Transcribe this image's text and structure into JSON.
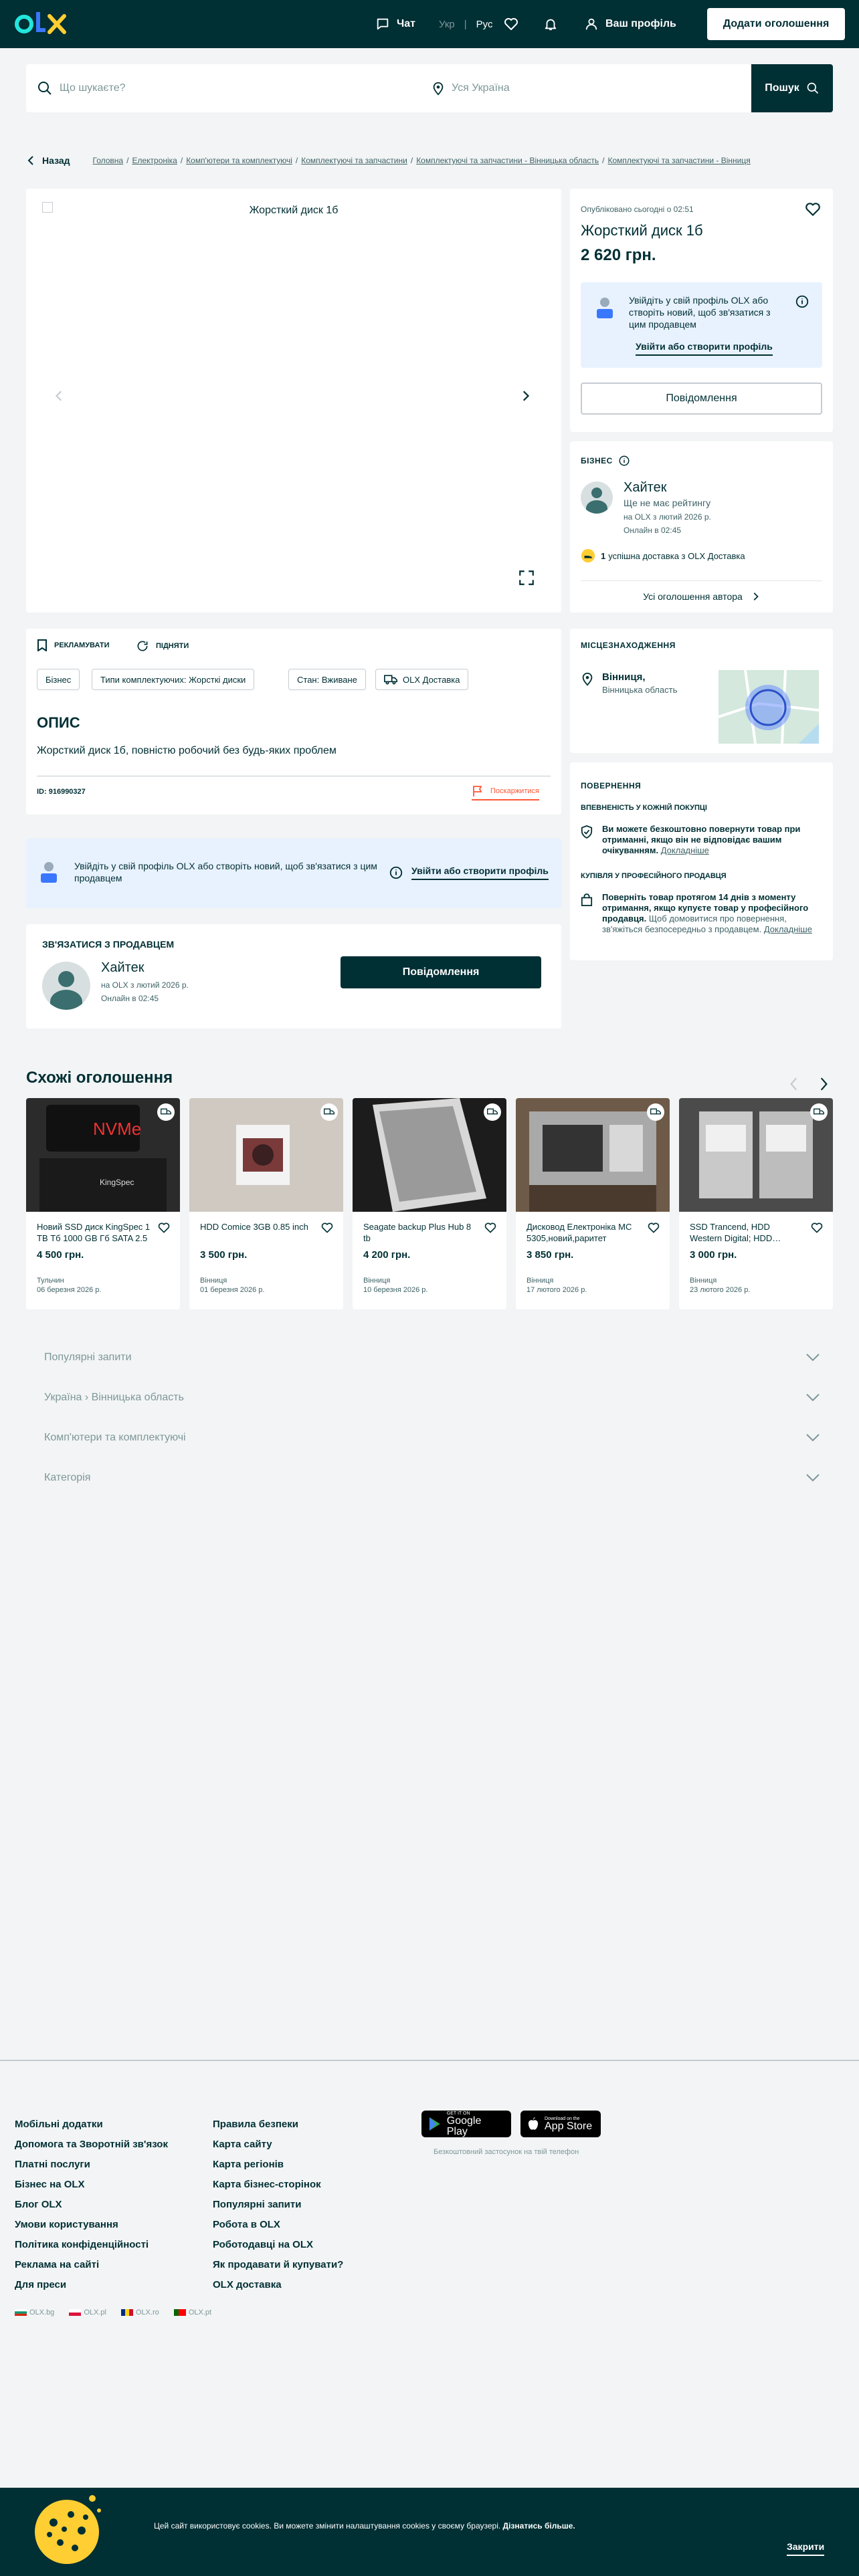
{
  "header": {
    "chat": "Чат",
    "lang_ukr": "Укр",
    "lang_rus": "Рус",
    "profile": "Ваш профіль",
    "add_listing": "Додати оголошення"
  },
  "search": {
    "placeholder": "Що шукаєте?",
    "location_placeholder": "Уся Україна",
    "button": "Пошук"
  },
  "breadcrumb": {
    "back": "Назад",
    "items": [
      "Головна",
      "Електроніка",
      "Комп'ютери та комплектуючі",
      "Комплектуючі та запчастини",
      "Комплектуючі та запчастини - Вінницька область",
      "Комплектуючі та запчастини - Вінниця"
    ]
  },
  "listing": {
    "image_alt": "Жорсткий диск 1б",
    "published": "Опубліковано сьогодні о 02:51",
    "title": "Жорсткий диск 1б",
    "price": "2 620 грн.",
    "login_prompt": "Увійдіть у свій профіль OLX або створіть новий, щоб зв'язатися з цим продавцем",
    "login_link": "Увійти або створити профіль",
    "message_button": "Повідомлення",
    "promote": "РЕКЛАМУВАТИ",
    "raise": "ПІДНЯТИ",
    "tags": [
      "Бізнес",
      "Типи комплектуючих: Жорсткі диски",
      "Стан: Вживане",
      "OLX Доставка"
    ],
    "description_heading": "ОПИС",
    "description": "Жорсткий диск 1б, повністю робочий без будь-яких проблем",
    "id_label": "ID: 916990327",
    "report": "Поскаржитися",
    "login_banner_text": "Увійдіть у свій профіль OLX або створіть новий, щоб зв'язатися з цим продавцем",
    "login_banner_link": "Увійти або створити профіль"
  },
  "seller": {
    "section": "БІЗНЕС",
    "name": "Хайтек",
    "rating": "Ще не має рейтингу",
    "since": "на OLX з лютий 2026 р.",
    "online": "Онлайн в 02:45",
    "delivery": "успішна доставка з OLX Доставка",
    "delivery_count": "1",
    "all_ads": "Усі оголошення автора"
  },
  "location": {
    "heading": "МІСЦЕЗНАХОДЖЕННЯ",
    "city": "Вінниця,",
    "region": "Вінницька область"
  },
  "returns": {
    "heading": "ПОВЕРНЕННЯ",
    "sub1": "ВПЕВНЕНІСТЬ У КОЖНІЙ ПОКУПЦІ",
    "text1": "Ви можете безкоштовно повернути товар при отриманні, якщо він не відповідає вашим очікуванням.",
    "link1": "Докладніше",
    "sub2": "КУПІВЛЯ У ПРОФЕСІЙНОГО ПРОДАВЦЯ",
    "text2_bold": "Поверніть товар протягом 14 днів з моменту отримання, якщо купуєте товар у професійного продавця.",
    "text2": "Щоб домовитися про повернення, зв'яжіться безпосередньо з продавцем.",
    "link2": "Докладніше"
  },
  "contact": {
    "heading": "ЗВ'ЯЗАТИСЯ З ПРОДАВЦЕМ",
    "name": "Хайтек",
    "since": "на OLX з лютий 2026 р.",
    "online": "Онлайн в 02:45",
    "button": "Повідомлення"
  },
  "similar": {
    "heading": "Схожі оголошення",
    "items": [
      {
        "title": "Новий SSD диск KingSpec 1 TB Тб 1000 GB Гб SATA 2.5",
        "price": "4 500 грн.",
        "location": "Тульчин",
        "date": "06 березня 2026 р."
      },
      {
        "title": "HDD Comice 3GB 0.85 inch",
        "price": "3 500 грн.",
        "location": "Вінниця",
        "date": "01 березня 2026 р."
      },
      {
        "title": "Seagate backup Plus Hub 8 tb",
        "price": "4 200 грн.",
        "location": "Вінниця",
        "date": "10 березня 2026 р."
      },
      {
        "title": "Дисковод Електроніка МС 5305,новий,раритет",
        "price": "3 850 грн.",
        "location": "Вінниця",
        "date": "17 лютого 2026 р."
      },
      {
        "title": "SSD Trancend, HDD Western Digital; HDD…",
        "price": "3 000 грн.",
        "location": "Вінниця",
        "date": "23 лютого 2026 р."
      }
    ]
  },
  "accordion": [
    "Популярні запити",
    "Україна › Вінницька область",
    "Комп'ютери та комплектуючі",
    "Категорія"
  ],
  "footer": {
    "col1": [
      "Мобільні додатки",
      "Допомога та Зворотній зв'язок",
      "Платні послуги",
      "Бізнес на OLX",
      "Блог OLX",
      "Умови користування",
      "Політика конфіденційності",
      "Реклама на сайті",
      "Для преси"
    ],
    "col2": [
      "Правила безпеки",
      "Карта сайту",
      "Карта регіонів",
      "Карта бізнес-сторінок",
      "Популярні запити",
      "Робота в OLX",
      "Роботодавці на OLX",
      "Як продавати й купувати?",
      "OLX доставка"
    ],
    "google_play_small": "GET IT ON",
    "google_play": "Google Play",
    "app_store_small": "Download on the",
    "app_store": "App Store",
    "apps_note": "Безкоштовний застосунок на твій телефон",
    "sites": [
      "OLX.bg",
      "OLX.pl",
      "OLX.ro",
      "OLX.pt"
    ]
  },
  "cookie": {
    "text": "Цей сайт використовує cookies. Ви можете змінити налаштування cookies у своєму браузері.",
    "link": "Дізнатись більше.",
    "close": "Закрити"
  }
}
